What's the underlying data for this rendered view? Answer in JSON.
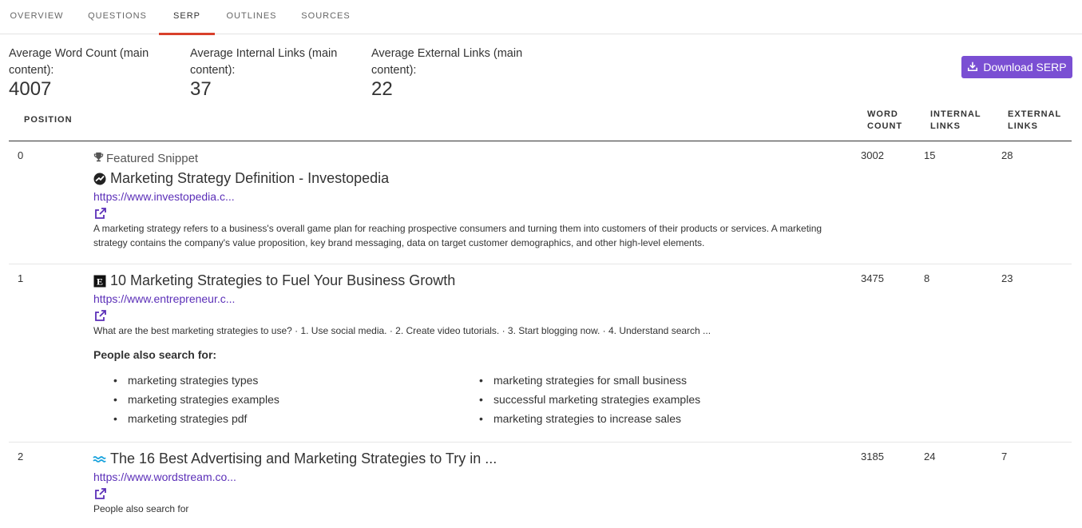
{
  "tabs": [
    "OVERVIEW",
    "QUESTIONS",
    "SERP",
    "OUTLINES",
    "SOURCES"
  ],
  "active_tab": "SERP",
  "stats": {
    "word_count": {
      "label": "Average Word Count (main content):",
      "value": "4007"
    },
    "internal_links": {
      "label": "Average Internal Links (main content):",
      "value": "37"
    },
    "external_links": {
      "label": "Average External Links (main content):",
      "value": "22"
    }
  },
  "download_button": {
    "label": "Download SERP",
    "icon": "download-icon"
  },
  "columns": {
    "position": "POSITION",
    "word_count_1": "WORD",
    "word_count_2": "COUNT",
    "internal_links_1": "INTERNAL",
    "internal_links_2": "LINKS",
    "external_links_1": "EXTERNAL",
    "external_links_2": "LINKS"
  },
  "results": [
    {
      "position": "0",
      "badge": "Featured Snippet",
      "title": "Marketing Strategy Definition - Investopedia",
      "url": "https://www.investopedia.c...",
      "description": "A marketing strategy refers to a business's overall game plan for reaching prospective consumers and turning them into customers of their products or services. A marketing strategy contains the company's value proposition, key brand messaging, data on target customer demographics, and other high-level elements.",
      "word_count": "3002",
      "internal_links": "15",
      "external_links": "28"
    },
    {
      "position": "1",
      "title": "10 Marketing Strategies to Fuel Your Business Growth",
      "url": "https://www.entrepreneur.c...",
      "description": "What are the best marketing strategies to use? · 1. Use social media. · 2. Create video tutorials. · 3. Start blogging now. · 4. Understand search ...",
      "people_also_search_title": "People also search for:",
      "people_also_search": [
        "marketing strategies types",
        "marketing strategies examples",
        "marketing strategies pdf",
        "marketing strategies for small business",
        "successful marketing strategies examples",
        "marketing strategies to increase sales"
      ],
      "word_count": "3475",
      "internal_links": "8",
      "external_links": "23"
    },
    {
      "position": "2",
      "title": "The 16 Best Advertising and Marketing Strategies to Try in ...",
      "url": "https://www.wordstream.co...",
      "description": "People also search for",
      "word_count": "3185",
      "internal_links": "24",
      "external_links": "7"
    }
  ],
  "colors": {
    "accent": "#7a4fd3",
    "tab_underline": "#d9402b",
    "link": "#5b2fb8"
  }
}
